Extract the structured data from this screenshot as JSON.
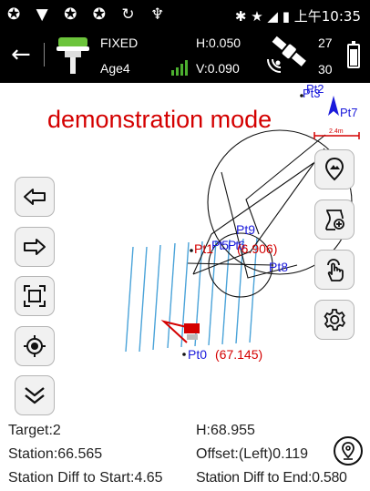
{
  "statusbar": {
    "left_icons": "✪ ▼ ✪ ✪ ↻ ♆",
    "right_icons": "✱ ★ ◢ ▮",
    "time": "上午10:35"
  },
  "toolbar": {
    "fix_status": "FIXED",
    "age": "Age4",
    "h_precision": "H:0.050",
    "v_precision": "V:0.090",
    "sat_used": "27",
    "sat_visible": "30"
  },
  "map": {
    "banner": "demonstration mode",
    "scale_label": "2.4m",
    "points": {
      "pt3": "Pt3",
      "pt2": "Pt2",
      "pt7": "Pt7",
      "pt9": "Pt9",
      "pt8": "Pt8",
      "pt1": "Pt1",
      "pt_elev1": "(6.906)",
      "pt0": "Pt0",
      "pt_elev0": "(67.145)"
    }
  },
  "info": {
    "target": "Target:2",
    "h": "H:68.955",
    "station": "Station:66.565",
    "offset": "Offset:(Left)0.119",
    "diff_start": "Station Diff to Start:4.65",
    "diff_end": "Station Diff to End:0.580"
  },
  "icons": {
    "back": "arrow-left-icon",
    "rover": "gnss-rover-icon",
    "satellite": "satellite-icon",
    "battery": "battery-icon"
  },
  "colors": {
    "accent_red": "#d40000",
    "point_blue": "#1a1adb",
    "line_cyan": "#4aa3d9"
  }
}
